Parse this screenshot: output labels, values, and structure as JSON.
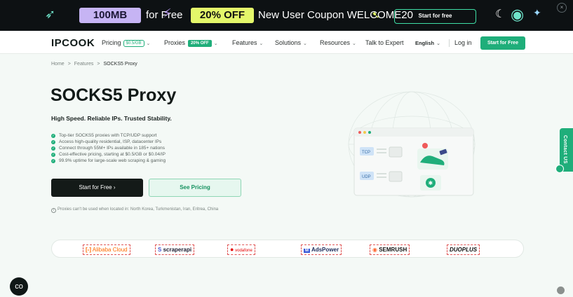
{
  "promo": {
    "mb_badge": "100MB",
    "for_free": "for Free",
    "off_badge": "20% OFF",
    "coupon_text": "New User Coupon WELCOME20",
    "cta": "Start for free",
    "close": "×",
    "colors": {
      "background": "#0d1113",
      "mb_badge": "#c6b4f4",
      "off_badge": "#e4f76a",
      "cta_border": "#3fe0a7"
    }
  },
  "nav": {
    "logo": "IPCOOK",
    "items": {
      "pricing": "Pricing",
      "pricing_badge": "$0.5/GB",
      "proxies": "Proxies",
      "proxies_badge": "20% OFF",
      "features": "Features",
      "solutions": "Solutions",
      "resources": "Resources",
      "talk": "Talk to Expert",
      "language": "English"
    },
    "chevron": "⌄",
    "login": "Log in",
    "cta": "Start for Free",
    "colors": {
      "accent": "#1fae7a"
    }
  },
  "breadcrumb": [
    "Home",
    "Features",
    "SOCKS5 Proxy"
  ],
  "breadcrumb_sep": ">",
  "hero": {
    "title": "SOCKS5 Proxy",
    "subtitle": "High Speed. Reliable IPs. Trusted Stability.",
    "features": [
      "Top-tier SOCKS5 proxies with TCP/UDP support",
      "Access high-quality residential, ISP, datacenter IPs",
      "Connect through 55M+ IPs available in 185+ nations",
      "Cost-effective pricing, starting at $0.5/GB or $0.04/IP",
      "99.9% uptime for large-scale web scraping & gaming"
    ],
    "primary_cta": "Start for Free  ›",
    "secondary_cta": "See Pricing",
    "note": "Proxies can't be used when located in: North Korea, Turkmenistan, Iran, Eritrea, China"
  },
  "illustration": {
    "tcp_label": "TCP",
    "udp_label": "UDP"
  },
  "contact_tab": "Contact US",
  "partners": [
    "Alibaba Cloud",
    "scraperapi",
    "vodafone",
    "AdsPower",
    "SEMRUSH",
    "DUOPLUS"
  ],
  "partner_colors": {
    "alibaba": "#ff6a00",
    "scraperapi": "#1a1a2e",
    "vodafone": "#e60000",
    "adspower": "#1b2a5a",
    "semrush": "#111111",
    "duoplus": "#111111"
  },
  "chat_icon": "co"
}
